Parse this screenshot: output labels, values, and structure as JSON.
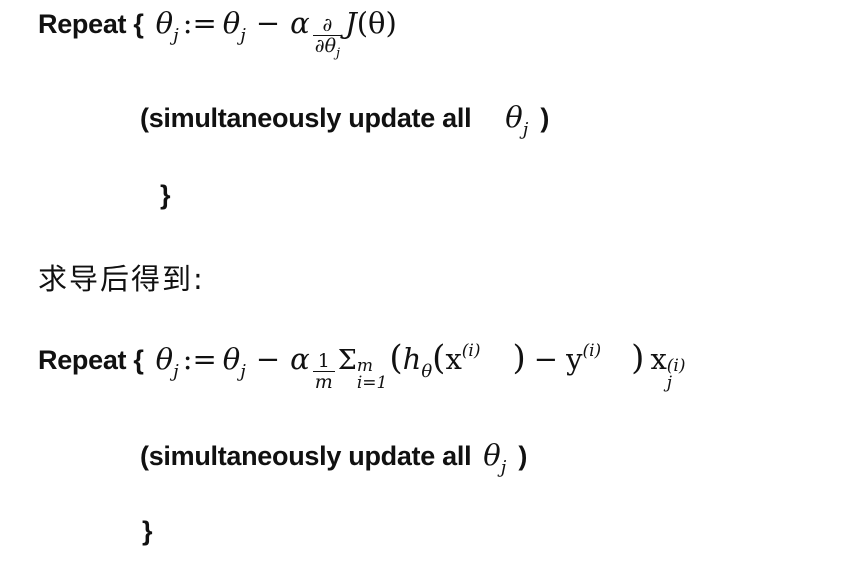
{
  "block1": {
    "repeat_label": "Repeat {",
    "update_note_open": "(simultaneously update all",
    "theta": "θ",
    "sub_j": "j",
    "update_note_close": ")",
    "closing_brace": "}"
  },
  "chinese_line": "求导后得到:",
  "block2": {
    "repeat_label": "Repeat {",
    "update_note_open": "(simultaneously update all",
    "theta": "θ",
    "sub_j": "j",
    "update_note_close": ")",
    "closing_brace": "}"
  },
  "math": {
    "theta": "θ",
    "j": "j",
    "assign": ":=",
    "minus": "−",
    "alpha": "α",
    "partial": "∂",
    "J": "J",
    "paren_theta": "(θ)",
    "one": "1",
    "m": "m",
    "sigma": "Σ",
    "sum_lower": "i=1",
    "sum_upper": "m",
    "h": "h",
    "x": "x",
    "y": "y",
    "sup_i": "(i)",
    "lparen": "(",
    "rparen": ")"
  }
}
